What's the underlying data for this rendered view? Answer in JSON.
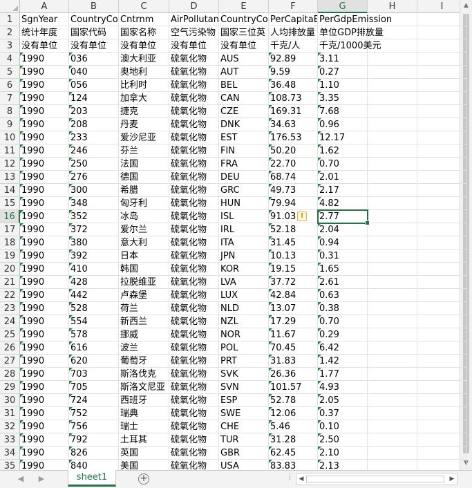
{
  "columns": [
    "A",
    "B",
    "C",
    "D",
    "E",
    "F",
    "G",
    "H",
    "I"
  ],
  "selected_cell": "G16",
  "rows": [
    {
      "n": "1",
      "cells": [
        "SgnYear",
        "CountryCo",
        "Cntrnm",
        "AirPollutan",
        "CountryCo",
        "PerCapitaE",
        "PerGdpEmission",
        "",
        ""
      ],
      "tri": false
    },
    {
      "n": "2",
      "cells": [
        "统计年度",
        "国家代码",
        "国家名称",
        "空气污染物",
        "国家三位英",
        "人均排放量",
        "单位GDP排放量",
        "",
        ""
      ],
      "tri": false
    },
    {
      "n": "3",
      "cells": [
        "没有单位",
        "没有单位",
        "没有单位",
        "没有单位",
        "没有单位",
        "千克/人",
        "千克/1000美元",
        "",
        ""
      ],
      "tri": false
    },
    {
      "n": "4",
      "cells": [
        "1990",
        "036",
        "澳大利亚",
        "硫氧化物",
        "AUS",
        "92.89",
        "3.11",
        "",
        ""
      ],
      "tri": true
    },
    {
      "n": "5",
      "cells": [
        "1990",
        "040",
        "奥地利",
        "硫氧化物",
        "AUT",
        "9.59",
        "0.27",
        "",
        ""
      ],
      "tri": true
    },
    {
      "n": "6",
      "cells": [
        "1990",
        "056",
        "比利时",
        "硫氧化物",
        "BEL",
        "36.48",
        "1.10",
        "",
        ""
      ],
      "tri": true
    },
    {
      "n": "7",
      "cells": [
        "1990",
        "124",
        "加拿大",
        "硫氧化物",
        "CAN",
        "108.73",
        "3.35",
        "",
        ""
      ],
      "tri": true
    },
    {
      "n": "8",
      "cells": [
        "1990",
        "203",
        "捷克",
        "硫氧化物",
        "CZE",
        "169.31",
        "7.68",
        "",
        ""
      ],
      "tri": true
    },
    {
      "n": "9",
      "cells": [
        "1990",
        "208",
        "丹麦",
        "硫氧化物",
        "DNK",
        "34.63",
        "0.96",
        "",
        ""
      ],
      "tri": true
    },
    {
      "n": "10",
      "cells": [
        "1990",
        "233",
        "爱沙尼亚",
        "硫氧化物",
        "EST",
        "176.53",
        "12.17",
        "",
        ""
      ],
      "tri": true
    },
    {
      "n": "11",
      "cells": [
        "1990",
        "246",
        "芬兰",
        "硫氧化物",
        "FIN",
        "50.20",
        "1.62",
        "",
        ""
      ],
      "tri": true
    },
    {
      "n": "12",
      "cells": [
        "1990",
        "250",
        "法国",
        "硫氧化物",
        "FRA",
        "22.70",
        "0.70",
        "",
        ""
      ],
      "tri": true
    },
    {
      "n": "13",
      "cells": [
        "1990",
        "276",
        "德国",
        "硫氧化物",
        "DEU",
        "68.74",
        "2.01",
        "",
        ""
      ],
      "tri": true
    },
    {
      "n": "14",
      "cells": [
        "1990",
        "300",
        "希腊",
        "硫氧化物",
        "GRC",
        "49.73",
        "2.17",
        "",
        ""
      ],
      "tri": true
    },
    {
      "n": "15",
      "cells": [
        "1990",
        "348",
        "匈牙利",
        "硫氧化物",
        "HUN",
        "79.94",
        "4.82",
        "",
        ""
      ],
      "tri": true
    },
    {
      "n": "16",
      "cells": [
        "1990",
        "352",
        "冰岛",
        "硫氧化物",
        "ISL",
        "91.03",
        "2.77",
        "",
        ""
      ],
      "tri": true
    },
    {
      "n": "17",
      "cells": [
        "1990",
        "372",
        "爱尔兰",
        "硫氧化物",
        "IRL",
        "52.18",
        "2.04",
        "",
        ""
      ],
      "tri": true
    },
    {
      "n": "18",
      "cells": [
        "1990",
        "380",
        "意大利",
        "硫氧化物",
        "ITA",
        "31.45",
        "0.94",
        "",
        ""
      ],
      "tri": true
    },
    {
      "n": "19",
      "cells": [
        "1990",
        "392",
        "日本",
        "硫氧化物",
        "JPN",
        "10.13",
        "0.31",
        "",
        ""
      ],
      "tri": true
    },
    {
      "n": "20",
      "cells": [
        "1990",
        "410",
        "韩国",
        "硫氧化物",
        "KOR",
        "19.15",
        "1.65",
        "",
        ""
      ],
      "tri": true
    },
    {
      "n": "21",
      "cells": [
        "1990",
        "428",
        "拉脱维亚",
        "硫氧化物",
        "LVA",
        "37.72",
        "2.61",
        "",
        ""
      ],
      "tri": true
    },
    {
      "n": "22",
      "cells": [
        "1990",
        "442",
        "卢森堡",
        "硫氧化物",
        "LUX",
        "42.84",
        "0.63",
        "",
        ""
      ],
      "tri": true
    },
    {
      "n": "23",
      "cells": [
        "1990",
        "528",
        "荷兰",
        "硫氧化物",
        "NLD",
        "13.07",
        "0.38",
        "",
        ""
      ],
      "tri": true
    },
    {
      "n": "24",
      "cells": [
        "1990",
        "554",
        "新西兰",
        "硫氧化物",
        "NZL",
        "17.29",
        "0.70",
        "",
        ""
      ],
      "tri": true
    },
    {
      "n": "25",
      "cells": [
        "1990",
        "578",
        "挪威",
        "硫氧化物",
        "NOR",
        "11.67",
        "0.29",
        "",
        ""
      ],
      "tri": true
    },
    {
      "n": "26",
      "cells": [
        "1990",
        "616",
        "波兰",
        "硫氧化物",
        "POL",
        "70.45",
        "6.42",
        "",
        ""
      ],
      "tri": true
    },
    {
      "n": "27",
      "cells": [
        "1990",
        "620",
        "葡萄牙",
        "硫氧化物",
        "PRT",
        "31.83",
        "1.42",
        "",
        ""
      ],
      "tri": true
    },
    {
      "n": "28",
      "cells": [
        "1990",
        "703",
        "斯洛伐克",
        "硫氧化物",
        "SVK",
        "26.36",
        "1.77",
        "",
        ""
      ],
      "tri": true
    },
    {
      "n": "29",
      "cells": [
        "1990",
        "705",
        "斯洛文尼亚",
        "硫氧化物",
        "SVN",
        "101.57",
        "4.93",
        "",
        ""
      ],
      "tri": true
    },
    {
      "n": "30",
      "cells": [
        "1990",
        "724",
        "西班牙",
        "硫氧化物",
        "ESP",
        "52.78",
        "2.05",
        "",
        ""
      ],
      "tri": true
    },
    {
      "n": "31",
      "cells": [
        "1990",
        "752",
        "瑞典",
        "硫氧化物",
        "SWE",
        "12.06",
        "0.37",
        "",
        ""
      ],
      "tri": true
    },
    {
      "n": "32",
      "cells": [
        "1990",
        "756",
        "瑞士",
        "硫氧化物",
        "CHE",
        "5.46",
        "0.10",
        "",
        ""
      ],
      "tri": true
    },
    {
      "n": "33",
      "cells": [
        "1990",
        "792",
        "土耳其",
        "硫氧化物",
        "TUR",
        "31.28",
        "2.50",
        "",
        ""
      ],
      "tri": true
    },
    {
      "n": "34",
      "cells": [
        "1990",
        "826",
        "英国",
        "硫氧化物",
        "GBR",
        "62.45",
        "2.10",
        "",
        ""
      ],
      "tri": true
    },
    {
      "n": "35",
      "cells": [
        "1990",
        "840",
        "美国",
        "硫氧化物",
        "USA",
        "83.83",
        "2.13",
        "",
        ""
      ],
      "tri": true
    }
  ],
  "warning_icon": "warning-icon",
  "sheet_tab": "sheet1",
  "add_sheet_label": "+",
  "nav_prev": "◀",
  "nav_next": "▶",
  "scroll_up": "▲",
  "scroll_down": "▼",
  "scroll_left": "◀",
  "scroll_right": "▶",
  "accent_color": "#217346"
}
